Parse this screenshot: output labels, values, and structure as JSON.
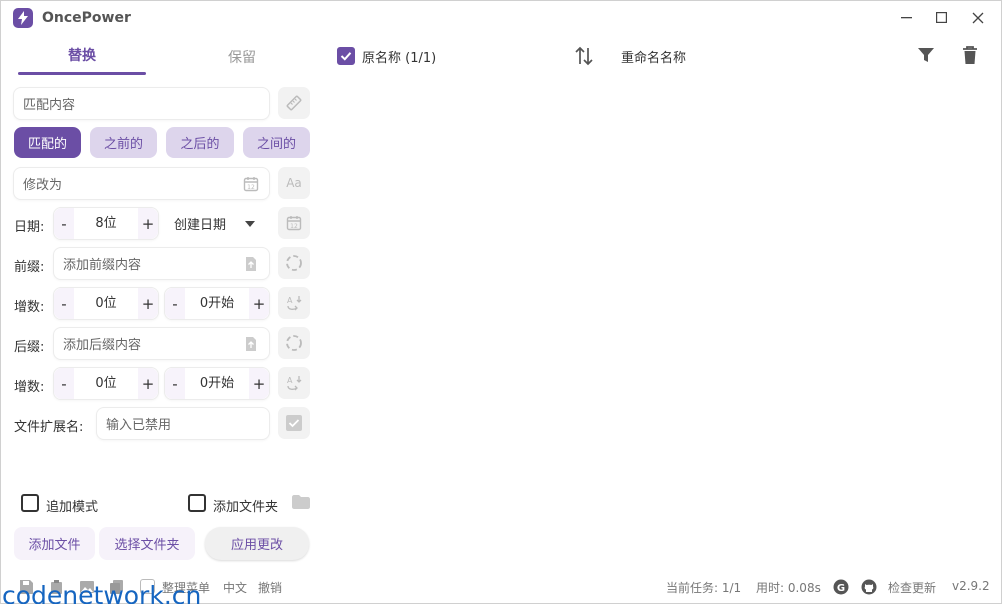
{
  "app": {
    "title": "OncePower"
  },
  "tabs": [
    {
      "label": "替换"
    },
    {
      "label": "保留"
    }
  ],
  "match": {
    "placeholder": "匹配内容"
  },
  "modes": [
    {
      "label": "匹配的"
    },
    {
      "label": "之前的"
    },
    {
      "label": "之后的"
    },
    {
      "label": "之间的"
    }
  ],
  "modify": {
    "placeholder": "修改为"
  },
  "date": {
    "label": "日期:",
    "digits": "8位",
    "type": "创建日期"
  },
  "prefix": {
    "label": "前缀:",
    "placeholder": "添加前缀内容"
  },
  "inc1": {
    "label": "增数:",
    "digits": "0位",
    "start": "0开始"
  },
  "suffix": {
    "label": "后缀:",
    "placeholder": "添加后缀内容"
  },
  "inc2": {
    "label": "增数:",
    "digits": "0位",
    "start": "0开始"
  },
  "ext": {
    "label": "文件扩展名:",
    "placeholder": "输入已禁用"
  },
  "options": {
    "append_mode": "追加模式",
    "add_folder": "添加文件夹"
  },
  "buttons": {
    "add_file": "添加文件",
    "select_folder": "选择文件夹",
    "apply": "应用更改"
  },
  "right": {
    "original_name": "原名称 (1/1)",
    "rename_name": "重命名名称"
  },
  "status": {
    "menu": "整理菜单",
    "lang": "中文",
    "undo": "撤销",
    "task": "当前任务: 1/1",
    "time": "用时: 0.08s",
    "check": "检查更新",
    "version": "v2.9.2"
  },
  "watermark": "codenetwork.cn",
  "colors": {
    "accent": "#6b4ea5",
    "accent_light": "#ddd5ec"
  }
}
